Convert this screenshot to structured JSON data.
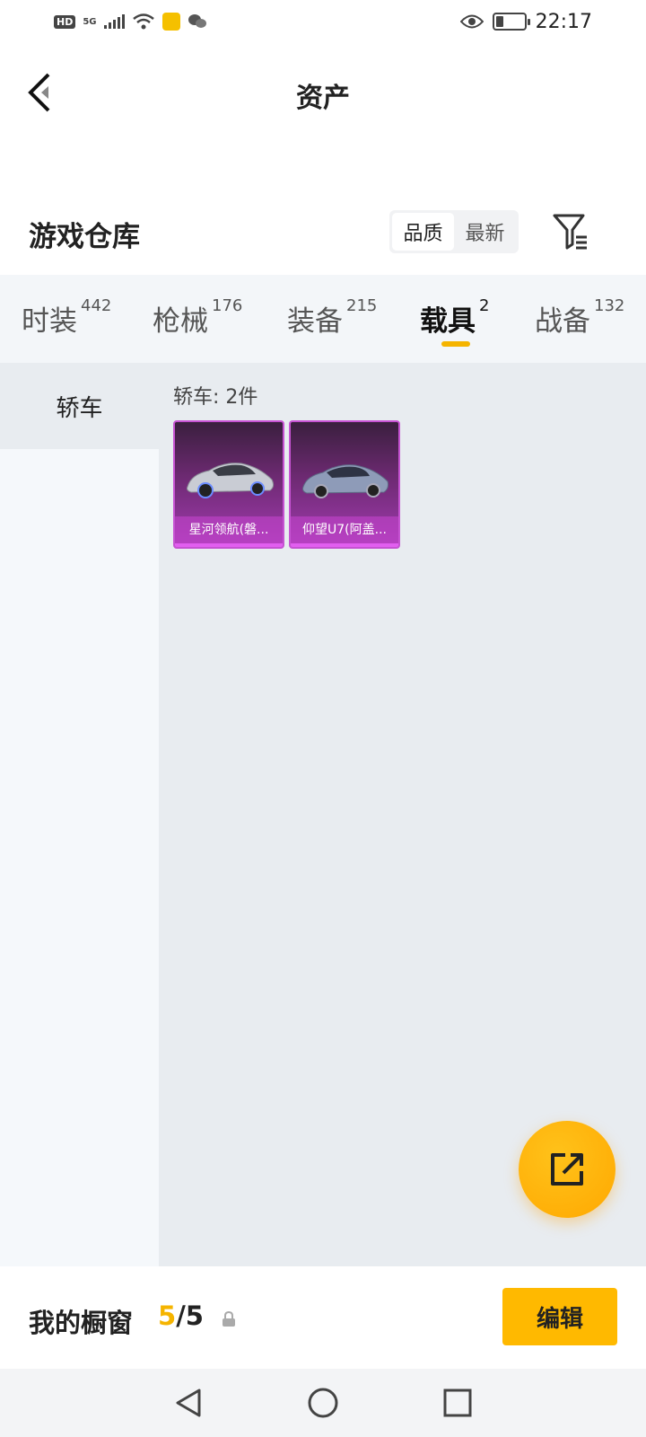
{
  "status_bar": {
    "hd": "HD",
    "network": "5G",
    "time": "22:17",
    "icons": [
      "hd-icon",
      "signal-icon",
      "wifi-icon",
      "app-icon",
      "wechat-icon",
      "eye-icon",
      "battery-icon"
    ]
  },
  "header": {
    "title": "资产",
    "back_icon": "back-icon"
  },
  "warehouse": {
    "title": "游戏仓库",
    "sort_options": [
      "品质",
      "最新"
    ],
    "sort_selected": "品质",
    "filter_icon": "filter-icon"
  },
  "tabs": [
    {
      "label": "时装",
      "count": "442"
    },
    {
      "label": "枪械",
      "count": "176"
    },
    {
      "label": "装备",
      "count": "215"
    },
    {
      "label": "载具",
      "count": "2"
    },
    {
      "label": "战备",
      "count": "132"
    }
  ],
  "active_tab": "载具",
  "sidebar": {
    "items": [
      {
        "label": "轿车"
      }
    ]
  },
  "content": {
    "count_label": "轿车: 2件",
    "items": [
      {
        "name": "星河领航(磐..."
      },
      {
        "name": "仰望U7(阿盖..."
      }
    ]
  },
  "fab": {
    "icon": "share-edit-icon"
  },
  "showcase": {
    "title": "我的橱窗",
    "current": "5",
    "separator": "/",
    "total": "5",
    "lock_icon": "lock-icon",
    "edit_label": "编辑"
  },
  "nav": {
    "icons": [
      "back-triangle-icon",
      "home-circle-icon",
      "recent-square-icon"
    ]
  },
  "colors": {
    "accent": "#f5b400",
    "card_purple": "#a23bb0",
    "fab": "#ffb300"
  }
}
